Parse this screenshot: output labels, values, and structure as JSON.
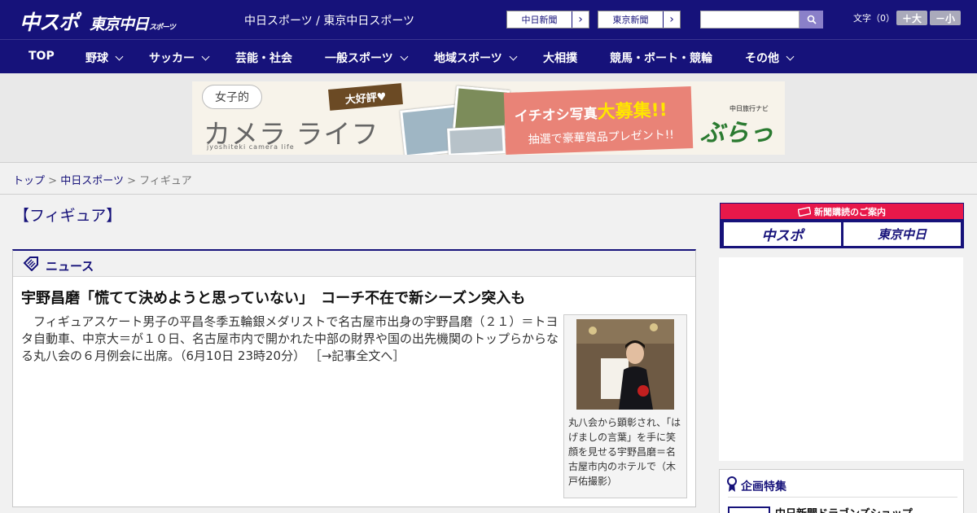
{
  "header": {
    "logo_main": "中スポ",
    "logo_sub": "東京中日",
    "logo_sub_small": "スポーツ",
    "site_desc": "中日スポーツ / 東京中日スポーツ",
    "link_chunichi": "中日新聞",
    "link_tokyo": "東京新聞",
    "link_arrow": "›",
    "search_placeholder": "",
    "font_size_label": "文字（0）",
    "font_bigger": "＋大",
    "font_smaller": "－小"
  },
  "nav": {
    "items": [
      {
        "label": "TOP"
      },
      {
        "label": "野球"
      },
      {
        "label": "サッカー"
      },
      {
        "label": "芸能・社会"
      },
      {
        "label": "一般スポーツ"
      },
      {
        "label": "地域スポーツ"
      },
      {
        "label": "大相撲"
      },
      {
        "label": "競馬・ボート・競輪"
      },
      {
        "label": "その他"
      }
    ]
  },
  "banner": {
    "bubble": "女子的",
    "title": "カメラ ライフ",
    "roman": "jyoshiteki camera life",
    "tag": "大好評♥",
    "headline_pre": "イチオシ写真",
    "headline_big": "大募集!!",
    "subline": "抽選で豪華賞品プレゼント!!",
    "brand_small": "中日旅行ナビ",
    "brand": "ぶらっ人"
  },
  "breadcrumb": {
    "top": "トップ",
    "sep": ">",
    "section": "中日スポーツ",
    "current": "フィギュア"
  },
  "page": {
    "title": "【フィギュア】"
  },
  "news": {
    "section_label": "ニュース",
    "headline": "宇野昌磨「慌てて決めようと思っていない」　コーチ不在で新シーズン突入も",
    "body": "　フィギュアスケート男子の平昌冬季五輪銀メダリストで名古屋市出身の宇野昌磨（２１）＝トヨタ自動車、中京大＝が１０日、名古屋市内で開かれた中部の財界や国の出先機関のトップらからなる丸八会の６月例会に出席。（6月10日 23時20分）",
    "more": "［→記事全文へ］",
    "caption": "丸八会から顕彰され、「はげましの言葉」を手に笑顔を見せる宇野昌磨＝名古屋市内のホテルで（木戸佑撮影）"
  },
  "sidebar": {
    "subscribe_head": "新聞購読のご案内",
    "sub_btn_1": "中スポ",
    "sub_btn_2": "東京中日",
    "feature_head": "企画特集",
    "feature_item": "中日新聞ドラゴンズショップ"
  },
  "colors": {
    "brand_navy": "#16127a",
    "accent_red": "#e8184a"
  }
}
